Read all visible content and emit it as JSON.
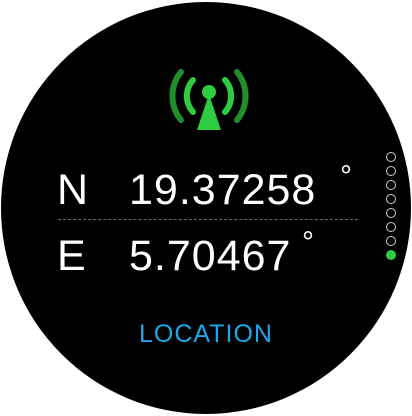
{
  "screen": {
    "icon": "signal-antenna-icon",
    "accent_color": "#2ecc40",
    "label_color": "#1ea7e8"
  },
  "coordinates": {
    "north": {
      "hemisphere": "N",
      "value": "19.37258",
      "unit": "°"
    },
    "east": {
      "hemisphere": "E",
      "value": "5.70467",
      "unit": "°"
    }
  },
  "footer": {
    "label": "LOCATION"
  },
  "pagination": {
    "total": 8,
    "active_index": 8
  }
}
